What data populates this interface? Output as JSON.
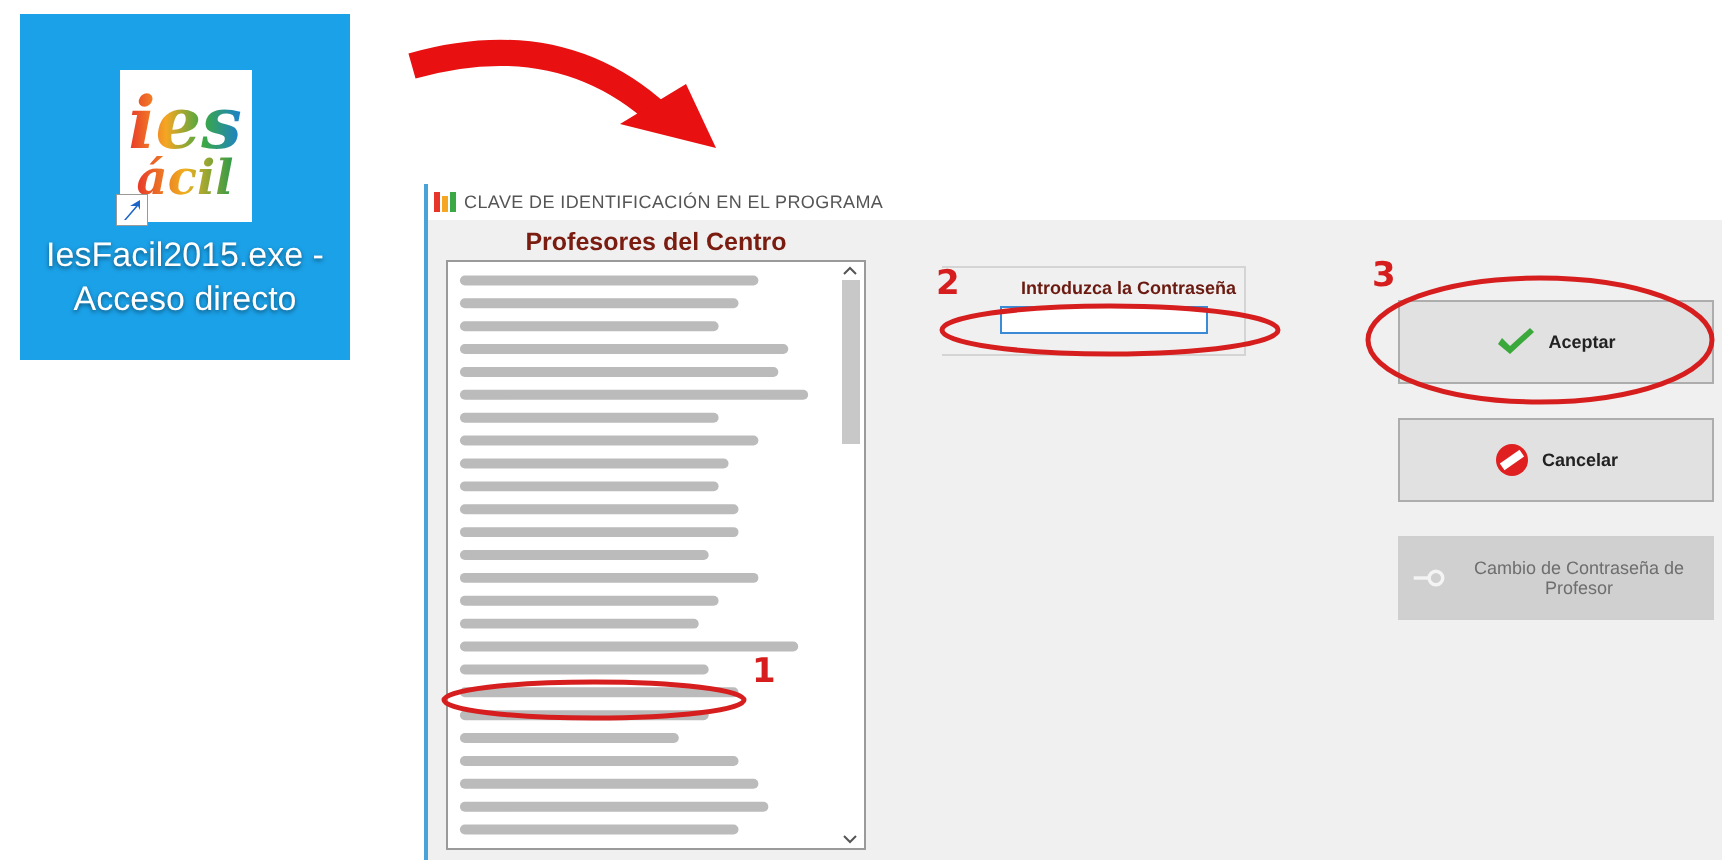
{
  "desktop_icon": {
    "logo_lines": [
      "ies",
      "ácil"
    ],
    "label": "IesFacil2015.exe - Acceso directo"
  },
  "window": {
    "title": "CLAVE DE IDENTIFICACIÓN EN EL PROGRAMA"
  },
  "teacher_list": {
    "heading": "Profesores del Centro"
  },
  "password": {
    "label": "Introduzca la Contraseña"
  },
  "buttons": [
    {
      "kind": "check",
      "label": "Aceptar",
      "disabled": false
    },
    {
      "kind": "cancel",
      "label": "Cancelar",
      "disabled": false
    },
    {
      "kind": "key",
      "label": "Cambio de Contraseña de Profesor",
      "disabled": true
    }
  ],
  "annotations": [
    {
      "label": "1"
    },
    {
      "label": "2"
    },
    {
      "label": "3"
    }
  ]
}
